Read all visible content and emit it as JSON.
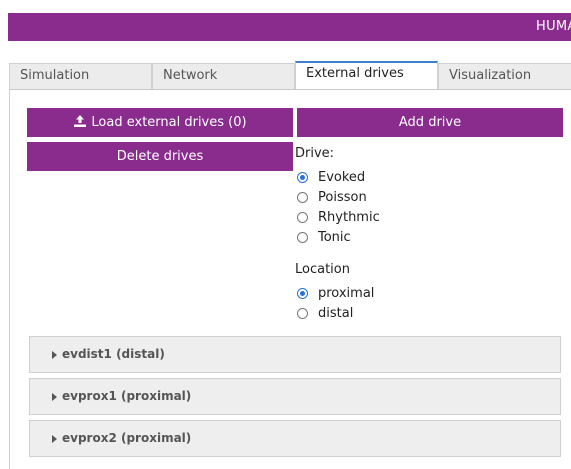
{
  "header": {
    "title": "HUMAN NEOCORTICAL NEUROSOLVER"
  },
  "tabs": [
    {
      "label": "Simulation"
    },
    {
      "label": "Network"
    },
    {
      "label": "External drives"
    },
    {
      "label": "Visualization"
    }
  ],
  "active_tab": "External drives",
  "buttons": {
    "load_label": "Load external drives (0)",
    "add_label": "Add drive",
    "delete_label": "Delete drives"
  },
  "drive": {
    "label": "Drive:",
    "options": [
      "Evoked",
      "Poisson",
      "Rhythmic",
      "Tonic"
    ],
    "selected": "Evoked"
  },
  "location": {
    "label": "Location",
    "options": [
      "proximal",
      "distal"
    ],
    "selected": "proximal"
  },
  "drives_list": [
    {
      "title": "evdist1 (distal)"
    },
    {
      "title": "evprox1 (proximal)"
    },
    {
      "title": "evprox2 (proximal)"
    }
  ],
  "colors": {
    "accent": "#8a2b8e",
    "radio_selected": "#2a72d6",
    "active_tab_border": "#3f7fce"
  }
}
